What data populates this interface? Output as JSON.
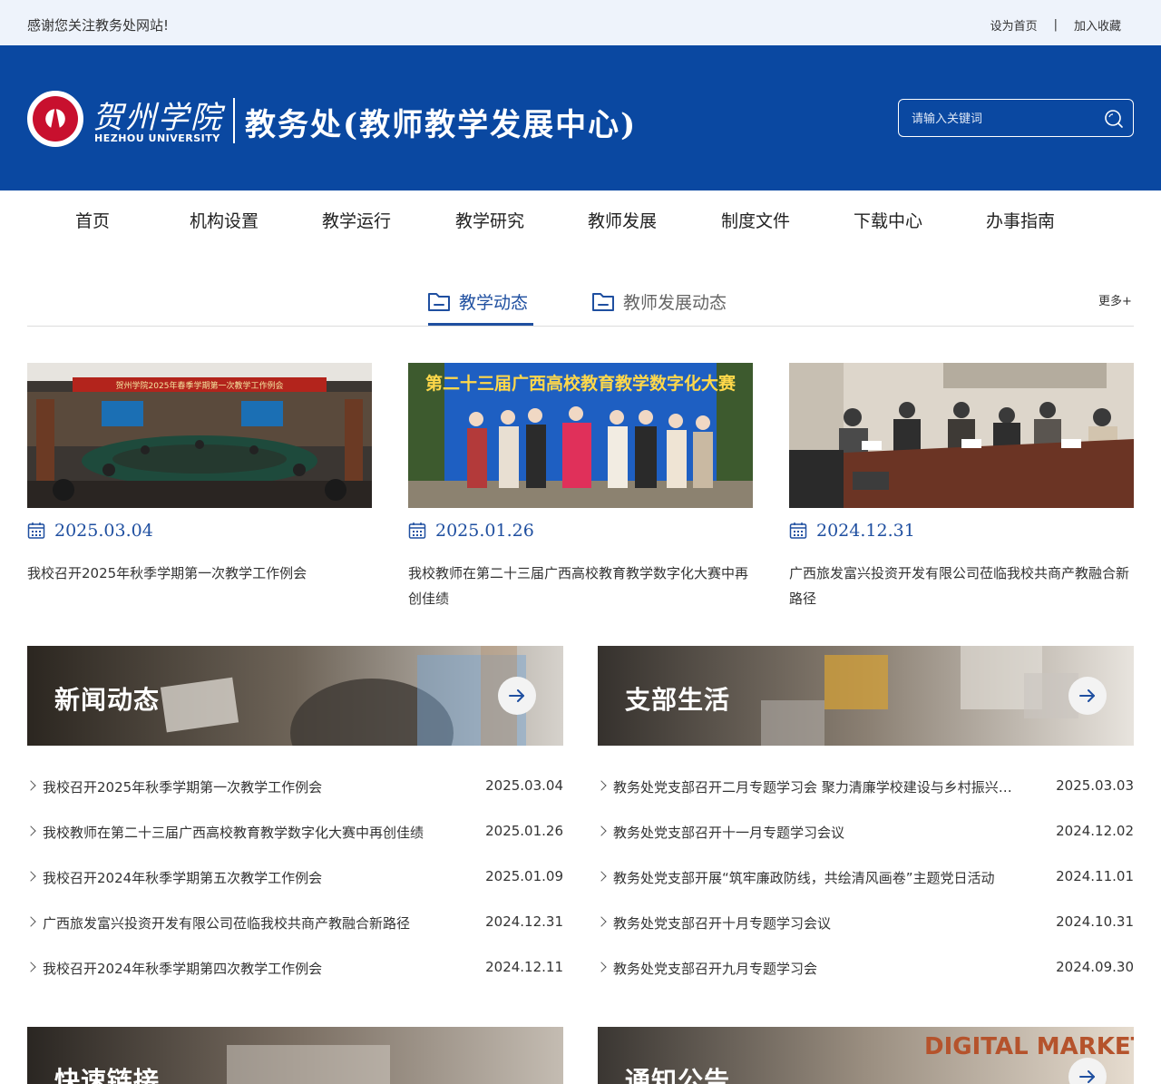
{
  "topbar": {
    "welcome": "感谢您关注教务处网站!",
    "set_home": "设为首页",
    "separator": "|",
    "add_favorite": "加入收藏"
  },
  "header": {
    "school_cn": "贺州学院",
    "school_en": "HEZHOU UNIVERSITY",
    "dept_title": "教务处(教师教学发展中心)",
    "search_placeholder": "请输入关键词"
  },
  "nav": {
    "items": [
      "首页",
      "机构设置",
      "教学运行",
      "教学研究",
      "教师发展",
      "制度文件",
      "下载中心",
      "办事指南"
    ]
  },
  "tabs": {
    "items": [
      {
        "label": "教学动态",
        "active": true
      },
      {
        "label": "教师发展动态",
        "active": false
      }
    ],
    "more": "更多+"
  },
  "cards": [
    {
      "date": "2025.03.04",
      "title": "我校召开2025年秋季学期第一次教学工作例会",
      "banner_text": "贺州学院2025年春季学期第一次教学工作例会"
    },
    {
      "date": "2025.01.26",
      "title": "我校教师在第二十三届广西高校教育教学数字化大赛中再创佳绩",
      "banner_text": "第二十三届广西高校教育教学数字化大赛"
    },
    {
      "date": "2024.12.31",
      "title": "广西旅发富兴投资开发有限公司莅临我校共商产教融合新路径"
    }
  ],
  "news": {
    "title": "新闻动态",
    "items": [
      {
        "text": "我校召开2025年秋季学期第一次教学工作例会",
        "date": "2025.03.04"
      },
      {
        "text": "我校教师在第二十三届广西高校教育教学数字化大赛中再创佳绩",
        "date": "2025.01.26"
      },
      {
        "text": "我校召开2024年秋季学期第五次教学工作例会",
        "date": "2025.01.09"
      },
      {
        "text": "广西旅发富兴投资开发有限公司莅临我校共商产教融合新路径",
        "date": "2024.12.31"
      },
      {
        "text": "我校召开2024年秋季学期第四次教学工作例会",
        "date": "2024.12.11"
      }
    ]
  },
  "party": {
    "title": "支部生活",
    "items": [
      {
        "text": "教务处党支部召开二月专题学习会 聚力清廉学校建设与乡村振兴…",
        "date": "2025.03.03"
      },
      {
        "text": "教务处党支部召开十一月专题学习会议",
        "date": "2024.12.02"
      },
      {
        "text": "教务处党支部开展“筑牢廉政防线，共绘清风画卷”主题党日活动",
        "date": "2024.11.01"
      },
      {
        "text": "教务处党支部召开十月专题学习会议",
        "date": "2024.10.31"
      },
      {
        "text": "教务处党支部召开九月专题学习会",
        "date": "2024.09.30"
      }
    ]
  },
  "quick_links": {
    "title": "快速链接"
  },
  "notices": {
    "title": "通知公告",
    "bg_text": "DIGITAL MARKETING"
  },
  "colors": {
    "header_blue": "#0a48a1",
    "accent_blue": "#1f4fa0",
    "topbar_bg": "#eef3fb"
  },
  "icons": [
    "search-icon",
    "folder-icon",
    "calendar-icon",
    "arrow-right-icon",
    "chevron-right-icon"
  ]
}
